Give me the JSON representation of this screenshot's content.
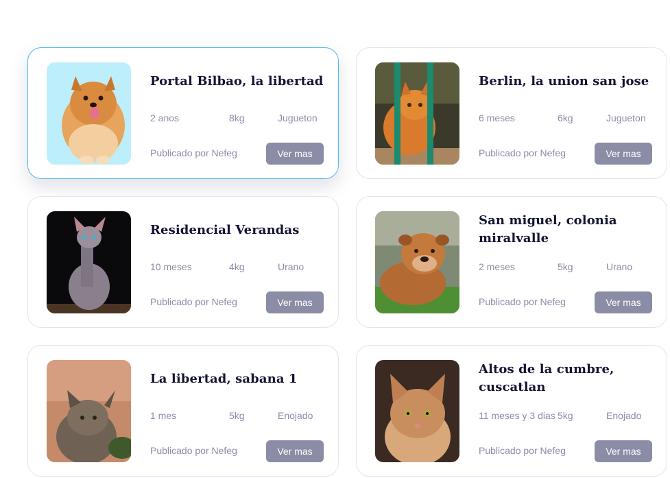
{
  "listings": [
    {
      "title": "Portal Bilbao, la libertad",
      "age": "2  anos",
      "weight": "8kg",
      "mood": "Jugueton",
      "publisher": "Publicado por Nefeg",
      "button": "Ver mas",
      "photo": "pomeranian-dog-photo"
    },
    {
      "title": "Berlin, la union  san jose",
      "age": "6 meses",
      "weight": "6kg",
      "mood": "Jugueton",
      "publisher": "Publicado por Nefeg",
      "button": "Ver mas",
      "photo": "orange-cat-behind-bars-photo"
    },
    {
      "title": "Residencial Verandas",
      "age": "10 meses",
      "weight": "4kg",
      "mood": "Urano",
      "publisher": "Publicado por Nefeg",
      "button": "Ver mas",
      "photo": "sphynx-cat-photo"
    },
    {
      "title": "San miguel, colonia miralvalle",
      "age": "2 meses",
      "weight": "5kg",
      "mood": "Urano",
      "publisher": "Publicado por Nefeg",
      "button": "Ver mas",
      "photo": "bulldog-puppy-photo"
    },
    {
      "title": "La libertad, sabana 1",
      "age": "1 mes",
      "weight": "5kg",
      "mood": "Enojado",
      "publisher": "Publicado por Nefeg",
      "button": "Ver mas",
      "photo": "tabby-cat-photo"
    },
    {
      "title": "Altos de la cumbre, cuscatlan",
      "age": "11 meses y 3 dias",
      "weight": "5kg",
      "mood": "Enojado",
      "publisher": "Publicado por Nefeg",
      "button": "Ver mas",
      "photo": "orange-tabby-cat-photo"
    }
  ]
}
